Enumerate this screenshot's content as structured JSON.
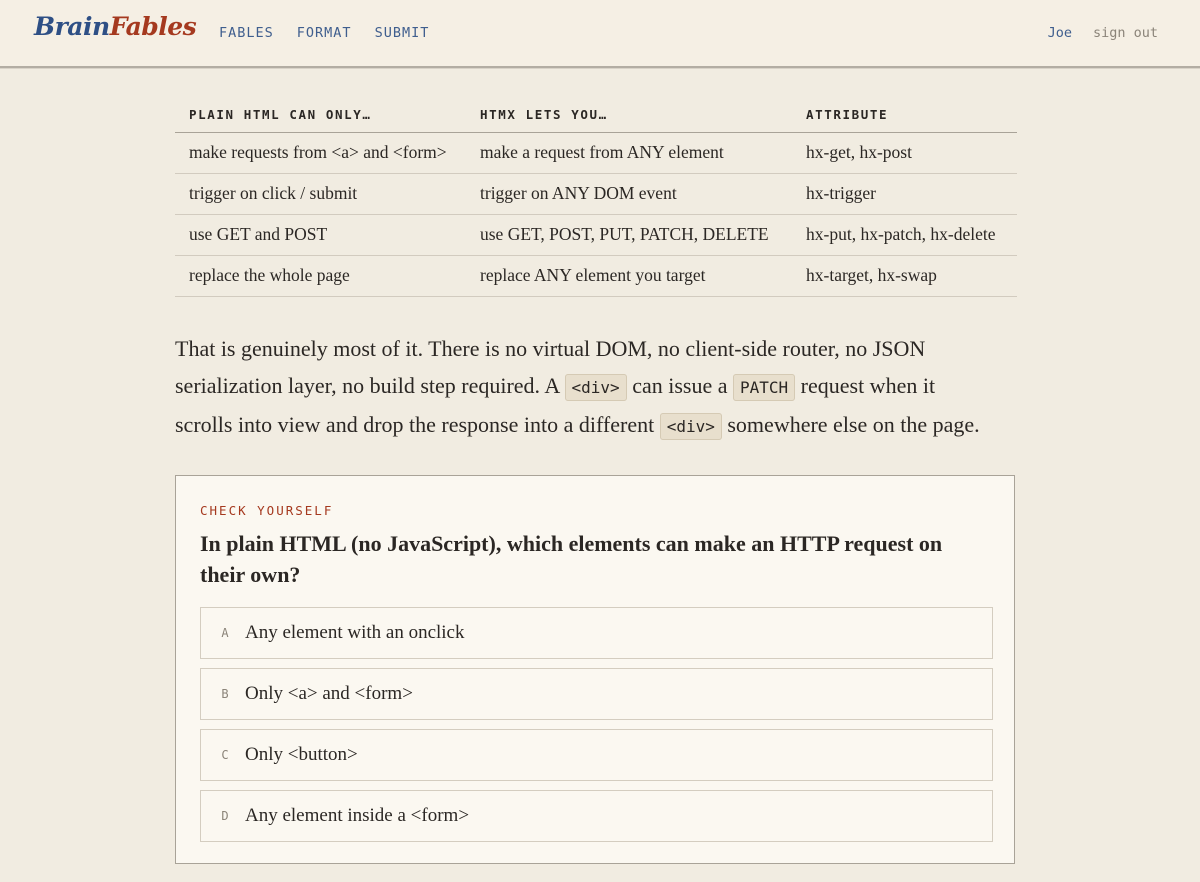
{
  "header": {
    "logo": {
      "part1": "Brain",
      "part2": "Fables"
    },
    "nav": [
      "FABLES",
      "FORMAT",
      "SUBMIT"
    ],
    "user": {
      "name": "Joe",
      "signout": "sign out"
    }
  },
  "table": {
    "headers": [
      "PLAIN HTML CAN ONLY…",
      "HTMX LETS YOU…",
      "ATTRIBUTE"
    ],
    "rows": [
      [
        "make requests from <a> and <form>",
        "make a request from ANY element",
        "hx-get, hx-post"
      ],
      [
        "trigger on click / submit",
        "trigger on ANY DOM event",
        "hx-trigger"
      ],
      [
        "use GET and POST",
        "use GET, POST, PUT, PATCH, DELETE",
        "hx-put, hx-patch, hx-delete"
      ],
      [
        "replace the whole page",
        "replace ANY element you target",
        "hx-target, hx-swap"
      ]
    ]
  },
  "prose": {
    "line1": "That is genuinely most of it. There is no virtual DOM, no client-side router, no JSON",
    "line2a": "serialization layer, no build step required. A",
    "code1": "<div>",
    "line2b": "can issue a",
    "code2": "PATCH",
    "line2c": "request when it",
    "line3a": "scrolls into view and drop the response into a different",
    "code3": "<div>",
    "line3b": "somewhere else on the page."
  },
  "quiz": {
    "eyebrow": "CHECK YOURSELF",
    "question": "In plain HTML (no JavaScript), which elements can make an HTTP request on their own?",
    "options": [
      {
        "letter": "A",
        "text": "Any element with an onclick"
      },
      {
        "letter": "B",
        "text": "Only <a> and <form>"
      },
      {
        "letter": "C",
        "text": "Only <button>"
      },
      {
        "letter": "D",
        "text": "Any element inside a <form>"
      }
    ]
  },
  "colors": {
    "brand_blue": "#2e4f85",
    "brand_red": "#a5391f",
    "background": "#f1ece1"
  }
}
